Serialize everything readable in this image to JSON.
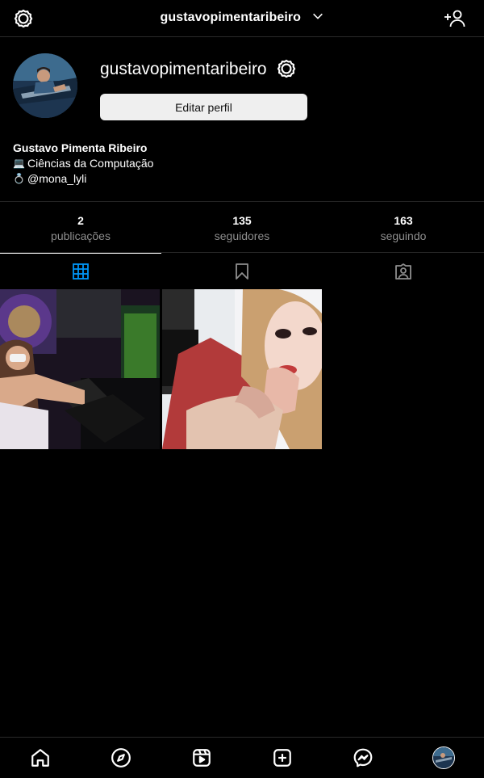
{
  "header": {
    "title": "gustavopimentaribeiro",
    "left_icon": "settings-icon",
    "right_icon": "add-user-icon"
  },
  "profile": {
    "username": "gustavopimentaribeiro",
    "edit_label": "Editar perfil",
    "full_name": "Gustavo Pimenta Ribeiro",
    "bio_lines": [
      {
        "emoji": "💻",
        "text": "Ciências da Computação"
      },
      {
        "emoji": "💍",
        "text": "@mona_lyli"
      }
    ]
  },
  "stats": [
    {
      "value": "2",
      "label": "publicações"
    },
    {
      "value": "135",
      "label": "seguidores"
    },
    {
      "value": "163",
      "label": "seguindo"
    }
  ],
  "tabs": [
    {
      "name": "grid-icon",
      "active": true
    },
    {
      "name": "saved-icon",
      "active": false
    },
    {
      "name": "tagged-icon",
      "active": false
    }
  ],
  "posts": [
    {
      "name": "post-arcade"
    },
    {
      "name": "post-portrait"
    }
  ],
  "bottom_nav": [
    "home-icon",
    "explore-icon",
    "reels-icon",
    "new-post-icon",
    "messenger-icon",
    "profile-avatar"
  ],
  "colors": {
    "background": "#000000",
    "accent": "#0095f6",
    "muted": "#8e8e8e"
  }
}
